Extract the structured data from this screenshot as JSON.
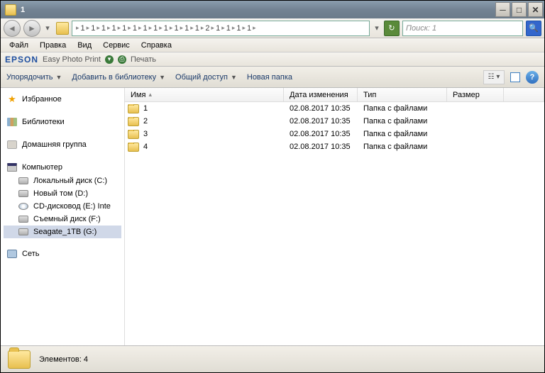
{
  "title": "1",
  "breadcrumb_segments": [
    "1",
    "1",
    "1",
    "1",
    "1",
    "1",
    "1",
    "1",
    "1",
    "1",
    "1",
    "1",
    "2",
    "1",
    "1",
    "1",
    "1"
  ],
  "search": {
    "placeholder": "Поиск: 1"
  },
  "menu": [
    "Файл",
    "Правка",
    "Вид",
    "Сервис",
    "Справка"
  ],
  "epson": {
    "logo": "EPSON",
    "app": "Easy Photo Print",
    "print": "Печать"
  },
  "toolbar": {
    "organize": "Упорядочить",
    "library": "Добавить в библиотеку",
    "share": "Общий доступ",
    "newfolder": "Новая папка"
  },
  "columns": {
    "name": "Имя",
    "date": "Дата изменения",
    "type": "Тип",
    "size": "Размер"
  },
  "sidebar": {
    "favorites": "Избранное",
    "libraries": "Библиотеки",
    "homegroup": "Домашняя группа",
    "computer": "Компьютер",
    "network": "Сеть",
    "drives": [
      "Локальный диск (C:)",
      "Новый том (D:)",
      "CD-дисковод (E:) Inte",
      "Съемный диск (F:)",
      "Seagate_1TB (G:)"
    ]
  },
  "files": [
    {
      "name": "1",
      "date": "02.08.2017 10:35",
      "type": "Папка с файлами",
      "size": ""
    },
    {
      "name": "2",
      "date": "02.08.2017 10:35",
      "type": "Папка с файлами",
      "size": ""
    },
    {
      "name": "3",
      "date": "02.08.2017 10:35",
      "type": "Папка с файлами",
      "size": ""
    },
    {
      "name": "4",
      "date": "02.08.2017 10:35",
      "type": "Папка с файлами",
      "size": ""
    }
  ],
  "status": {
    "items_label": "Элементов: 4"
  }
}
